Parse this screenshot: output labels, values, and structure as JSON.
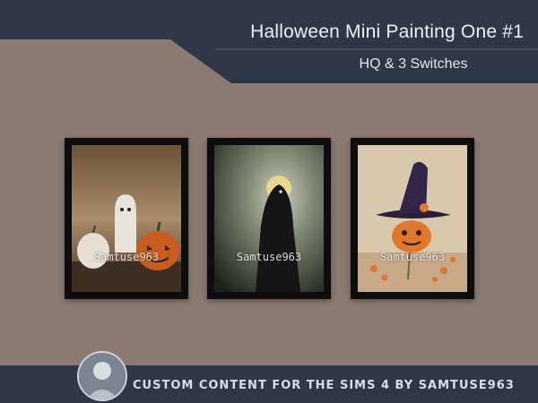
{
  "header": {
    "title": "Halloween Mini Painting One #1",
    "subtitle": "HQ & 3 Switches"
  },
  "paintings": [
    {
      "name": "ghost-and-pumpkins",
      "watermark": "Samtuse963"
    },
    {
      "name": "hooded-figure",
      "watermark": "Samtuse963"
    },
    {
      "name": "witch-hat-pumpkin",
      "watermark": "Samtuse963"
    }
  ],
  "footer": {
    "text": "CUSTOM CONTENT FOR THE SIMS 4 BY SAMTUSE963"
  },
  "colors": {
    "background": "#8a7a72",
    "banner": "#2f3746",
    "footer": "#2f3746"
  }
}
